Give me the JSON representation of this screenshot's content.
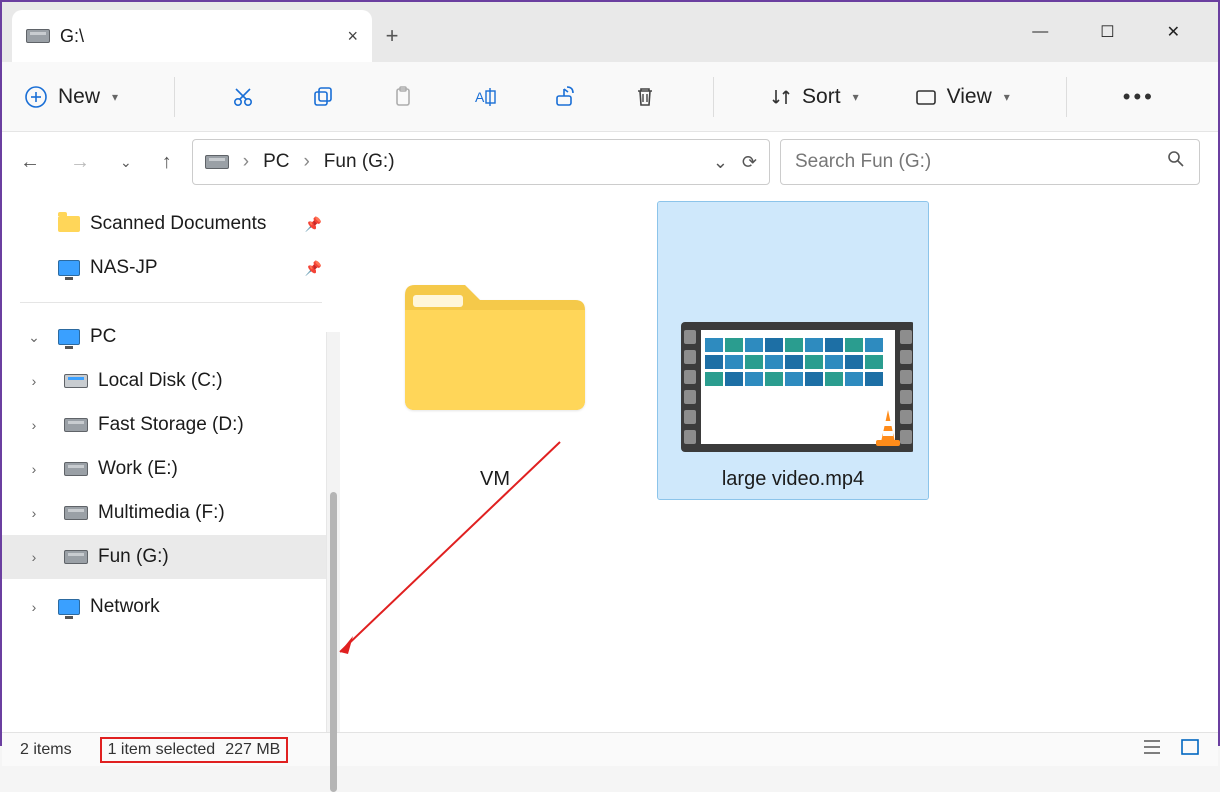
{
  "window": {
    "tabTitle": "G:\\",
    "tabClose": "×",
    "newTab": "+",
    "minimize": "—",
    "maximize": "☐",
    "close": "✕"
  },
  "toolbar": {
    "new_label": "New",
    "sort_label": "Sort",
    "view_label": "View"
  },
  "breadcrumb": {
    "root": "PC",
    "sep": "›",
    "leaf": "Fun (G:)"
  },
  "search": {
    "placeholder": "Search Fun (G:)"
  },
  "sidebar": {
    "scanned": "Scanned Documents",
    "nas": "NAS-JP",
    "pc": "PC",
    "localc": "Local Disk (C:)",
    "fastd": "Fast Storage (D:)",
    "worke": "Work (E:)",
    "multif": "Multimedia (F:)",
    "fung": "Fun (G:)",
    "network": "Network"
  },
  "files": {
    "vm": "VM",
    "video": "large video.mp4"
  },
  "status": {
    "count": "2 items",
    "selected": "1 item selected",
    "size": "227 MB"
  }
}
